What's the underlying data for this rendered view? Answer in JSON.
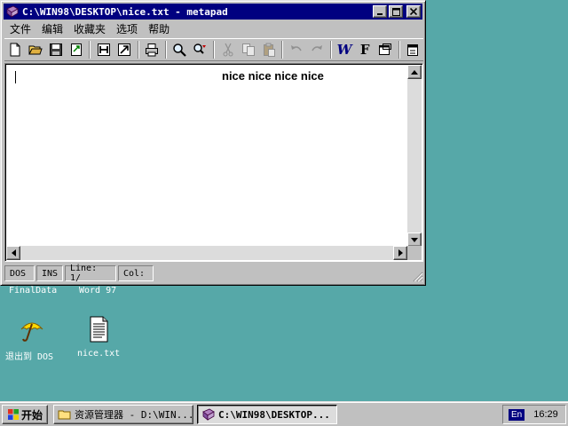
{
  "window": {
    "title": "C:\\WIN98\\DESKTOP\\nice.txt - metapad",
    "minimize_symbol": "_",
    "maximize_symbol": "□",
    "close_symbol": "×"
  },
  "menu": {
    "items": [
      {
        "label": "文件"
      },
      {
        "label": "编辑"
      },
      {
        "label": "收藏夹"
      },
      {
        "label": "选项"
      },
      {
        "label": "帮助"
      }
    ]
  },
  "toolbar": {
    "bold_w_label": "W",
    "font_f_label": "F"
  },
  "editor": {
    "content": "nice nice nice nice"
  },
  "statusbar": {
    "format": "DOS",
    "insert_mode": "INS",
    "line": "Line: 1/",
    "col": "Col:"
  },
  "desktop": {
    "partial_labels": [
      "FinalData",
      "Word 97"
    ],
    "icons": [
      {
        "label": "退出到 DOS",
        "icon": "umbrella-icon"
      },
      {
        "label": "nice.txt",
        "icon": "text-file-icon"
      }
    ]
  },
  "taskbar": {
    "start_label": "开始",
    "tasks": [
      {
        "label": "资源管理器 - D:\\WIN..."
      },
      {
        "label": "C:\\WIN98\\DESKTOP..."
      }
    ],
    "language": "En",
    "clock": "16:29"
  },
  "colors": {
    "desktop": "#56a8a8",
    "titlebar": "#000080",
    "face": "#c0c0c0"
  }
}
